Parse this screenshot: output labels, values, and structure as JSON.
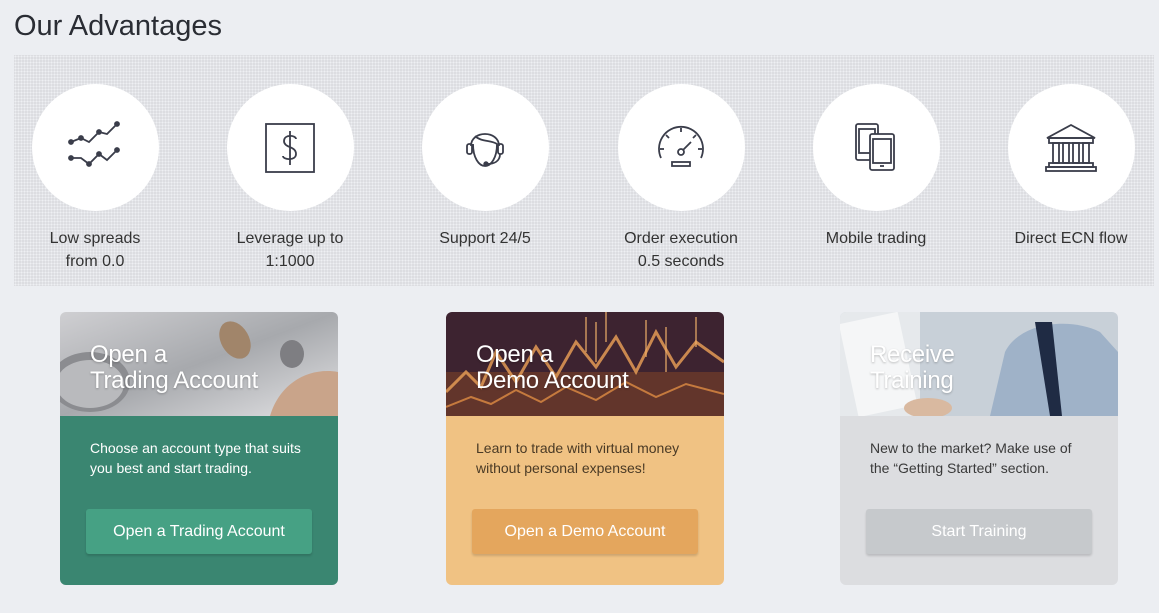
{
  "page_title": "Our Advantages",
  "advantages": [
    {
      "label": "Low spreads\nfrom 0.0",
      "icon": "chart-lines-icon"
    },
    {
      "label": "Leverage up to\n1:1000",
      "icon": "dollar-icon"
    },
    {
      "label": "Support 24/5",
      "icon": "headset-icon"
    },
    {
      "label": "Order execution\n0.5 seconds",
      "icon": "speedometer-icon"
    },
    {
      "label": "Mobile trading",
      "icon": "mobile-devices-icon"
    },
    {
      "label": "Direct ECN flow",
      "icon": "bank-icon"
    }
  ],
  "cards": [
    {
      "title": "Open a\nTrading Account",
      "text": "Choose an account type that suits you best and start trading.",
      "button": "Open a Trading Account",
      "color": "#3a8671"
    },
    {
      "title": "Open a\nDemo Account",
      "text": "Learn to trade with virtual money without personal expenses!",
      "button": "Open a Demo Account",
      "color": "#f0c283"
    },
    {
      "title": "Receive\nTraining",
      "text": "New to the market? Make use of the “Getting Started” section.",
      "button": "Start Training",
      "color": "#dcdde0"
    }
  ]
}
